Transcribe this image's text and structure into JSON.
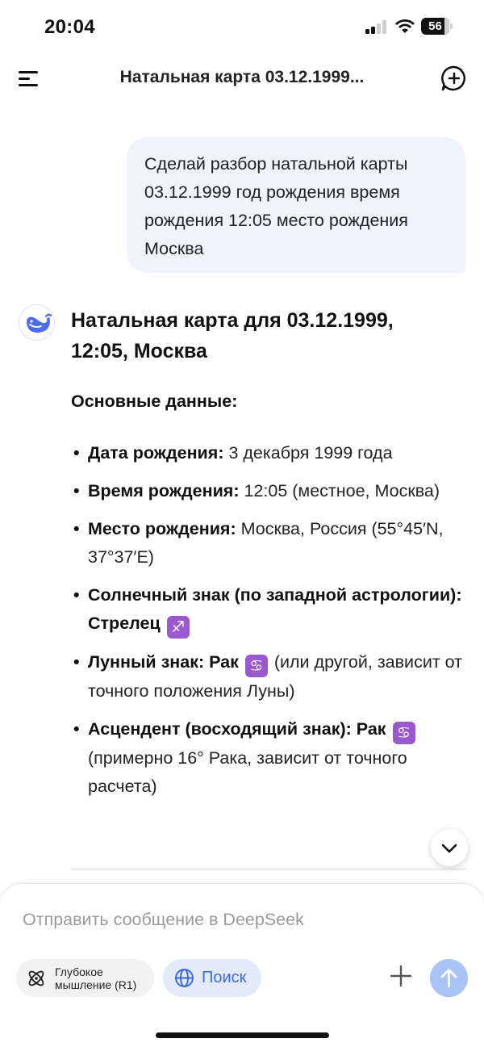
{
  "status_bar": {
    "time": "20:04",
    "battery": "56"
  },
  "header": {
    "title": "Натальная карта 03.12.1999..."
  },
  "user_message": {
    "text": "Сделай разбор натальной карты 03.12.1999 год рождения время рождения 12:05 место рождения Москва"
  },
  "answer": {
    "title": "Натальная карта для 03.12.1999, 12:05, Москва",
    "section_title": "Основные данные:",
    "facts": [
      {
        "label": "Дата рождения:",
        "value": " 3 декабря 1999 года"
      },
      {
        "label": "Время рождения:",
        "value": " 12:05 (местное, Москва)"
      },
      {
        "label": "Место рождения:",
        "value": " Москва, Россия (55°45′N, 37°37′E)"
      },
      {
        "label": "Солнечный знак (по западной астрологии): Стрелец",
        "glyph": "♐",
        "value": ""
      },
      {
        "label": "Лунный знак: Рак",
        "glyph": "♋",
        "value": " (или другой, зависит от точного положения Луны)"
      },
      {
        "label": "Асцендент (восходящий знак): Рак",
        "glyph": "♋",
        "value": " (примерно 16° Рака, зависит от точного расчета)"
      }
    ]
  },
  "composer": {
    "placeholder": "Отправить сообщение в DeepSeek",
    "deep_think_label": "Глубокое мышление (R1)",
    "search_label": "Поиск"
  },
  "colors": {
    "accent": "#3d6ad6",
    "bubble": "#eef3fc",
    "send": "#a9c3f7",
    "zodiac": "#9b59d0"
  },
  "icons": [
    "menu-icon",
    "new-chat-icon",
    "deepseek-whale-icon",
    "chevron-down-icon",
    "atom-icon",
    "globe-icon",
    "plus-icon",
    "arrow-up-icon"
  ]
}
